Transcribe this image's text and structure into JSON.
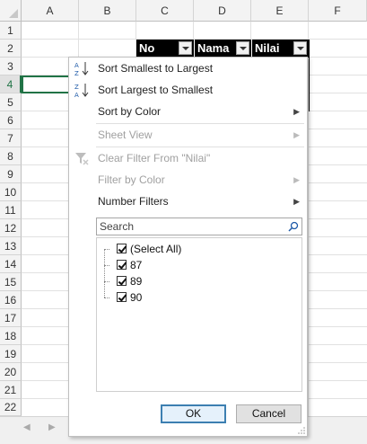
{
  "sheet": {
    "columns": [
      "A",
      "B",
      "C",
      "D",
      "E",
      "F"
    ],
    "rows": [
      "1",
      "2",
      "3",
      "4",
      "5",
      "6",
      "7",
      "8",
      "9",
      "10",
      "11",
      "12",
      "13",
      "14",
      "15",
      "16",
      "17",
      "18",
      "19",
      "20",
      "21",
      "22"
    ],
    "active_row": "4",
    "header_cells": {
      "no": "No",
      "nama": "Nama",
      "nilai": "Nilai"
    }
  },
  "menu": {
    "items": [
      {
        "label": "Sort Smallest to Largest",
        "icon": "sort-ascending-icon",
        "disabled": false
      },
      {
        "label": "Sort Largest to Smallest",
        "icon": "sort-descending-icon",
        "disabled": false
      },
      {
        "label": "Sort by Color",
        "disabled": false,
        "submenu": true
      },
      {
        "label": "Sheet View",
        "disabled": true,
        "submenu": true
      },
      {
        "label": "Clear Filter From \"Nilai\"",
        "icon": "clear-filter-icon",
        "disabled": true
      },
      {
        "label": "Filter by Color",
        "disabled": true,
        "submenu": true
      },
      {
        "label": "Number Filters",
        "disabled": false,
        "submenu": true
      }
    ],
    "search_placeholder": "Search",
    "list": [
      {
        "label": "(Select All)",
        "checked": true
      },
      {
        "label": "87",
        "checked": true
      },
      {
        "label": "89",
        "checked": true
      },
      {
        "label": "90",
        "checked": true
      }
    ],
    "ok_label": "OK",
    "cancel_label": "Cancel"
  }
}
